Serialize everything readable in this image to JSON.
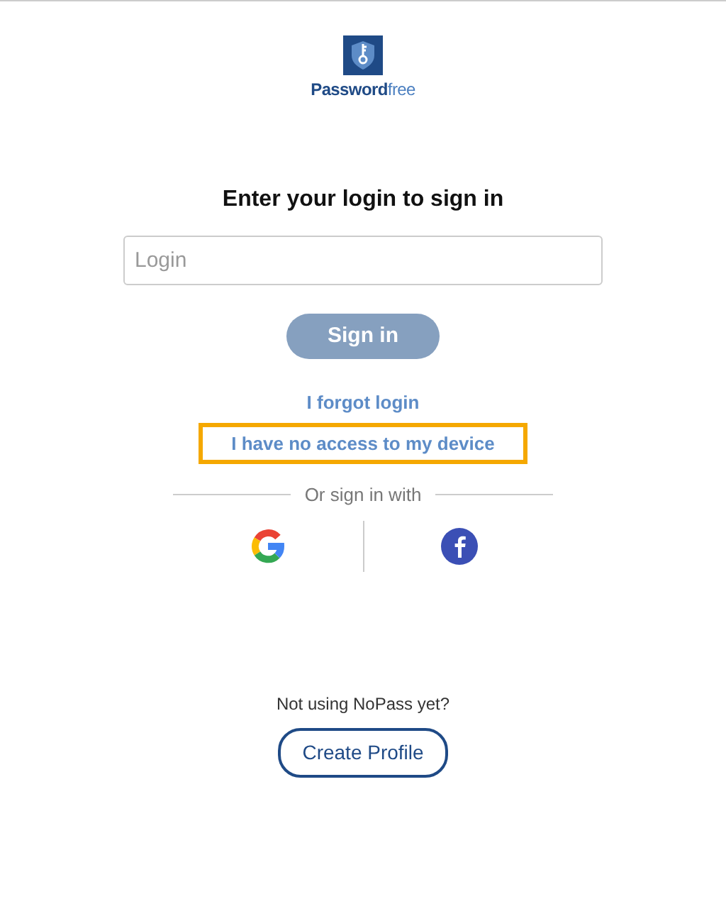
{
  "logo": {
    "text_main": "Password",
    "text_accent": "free"
  },
  "heading": "Enter your login to sign in",
  "login_field": {
    "placeholder": "Login"
  },
  "sign_in_button": {
    "label": "Sign in",
    "disabled": true
  },
  "links": [
    {
      "label": "I forgot login",
      "highlighted": false
    },
    {
      "label": "I have no access to my device",
      "highlighted": true
    }
  ],
  "divider_label": "Or sign in with",
  "social": [
    {
      "kind": "google"
    },
    {
      "kind": "facebook"
    }
  ],
  "signup_prompt": "Not using NoPass yet?",
  "create_profile_button": {
    "label": "Create Profile"
  }
}
